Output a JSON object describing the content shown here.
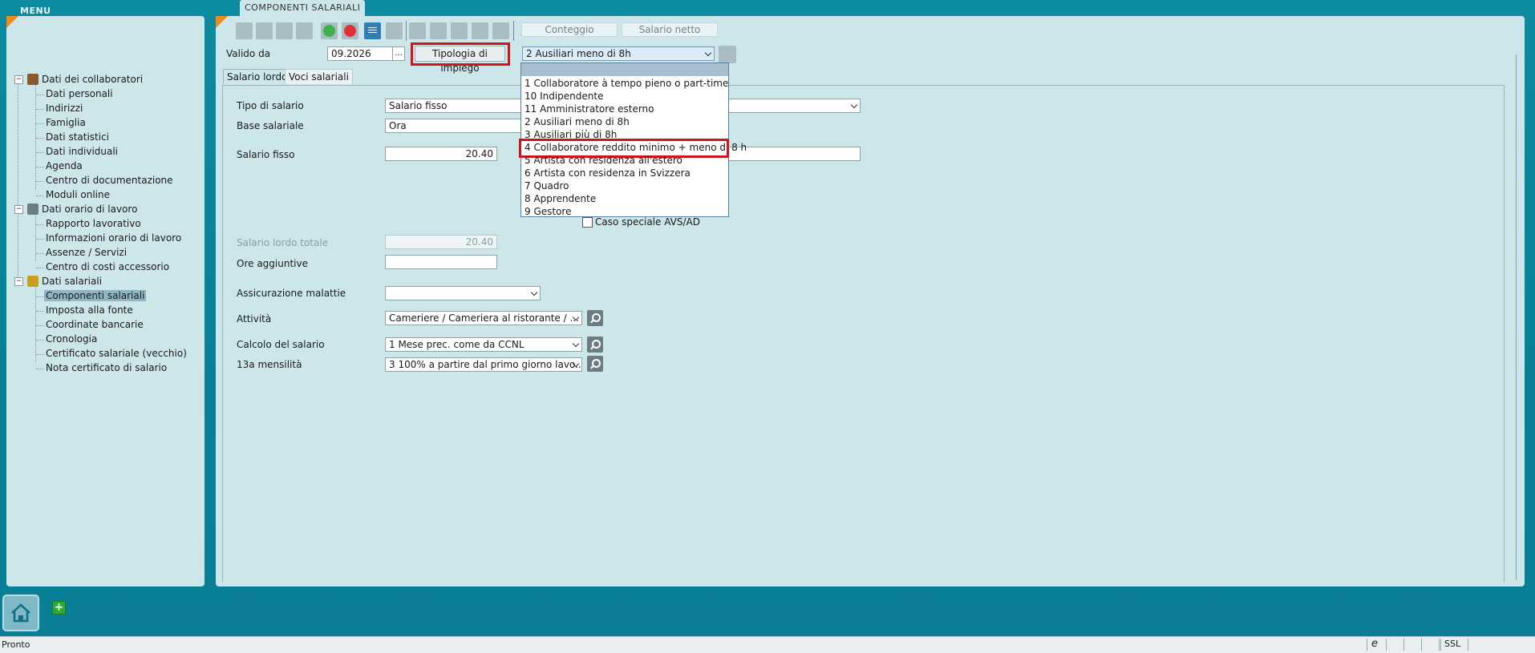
{
  "menu": {
    "title": "MENU",
    "tree": [
      {
        "group": "Dati dei collaboratori",
        "icon": "person-icon",
        "items": [
          "Dati personali",
          "Indirizzi",
          "Famiglia",
          "Dati statistici",
          "Dati individuali",
          "Agenda",
          "Centro di documentazione",
          "Moduli online"
        ]
      },
      {
        "group": "Dati orario di lavoro",
        "icon": "calendar-icon",
        "items": [
          "Rapporto lavorativo",
          "Informazioni orario di lavoro",
          "Assenze / Servizi",
          "Centro di costi accessorio"
        ]
      },
      {
        "group": "Dati salariali",
        "icon": "money-icon",
        "items": [
          "Componenti salariali",
          "Imposta alla fonte",
          "Coordinate bancarie",
          "Cronologia",
          "Certificato salariale (vecchio)",
          "Nota certificato di salario"
        ]
      }
    ],
    "selected": "Componenti salariali"
  },
  "window": {
    "tab_title": "COMPONENTI SALARIALI"
  },
  "toolbar": {
    "conteggio": "Conteggio",
    "salario_netto": "Salario netto"
  },
  "header": {
    "valido_da_label": "Valido da",
    "valido_da_value": "09.2026",
    "picker_label": "...",
    "tipologia_button": "Tipologia di impiego",
    "tipologia_value": "2 Ausiliari meno di 8h"
  },
  "tabs": [
    "Salario lordo",
    "Voci salariali"
  ],
  "dropdown": {
    "options": [
      "1 Collaboratore à tempo pieno o part-time",
      "10 Indipendente",
      "11 Amministratore esterno",
      "2 Ausiliari meno di 8h",
      "3 Ausiliari più di 8h",
      "4 Collaboratore reddito minimo + meno di 8 h",
      "5 Artista con residenza all'estero",
      "6 Artista con residenza in Svizzera",
      "7 Quadro",
      "8 Apprendente",
      "9 Gestore"
    ],
    "highlighted": "4 Collaboratore reddito minimo + meno di 8 h"
  },
  "form": {
    "tipo_salario_label": "Tipo di salario",
    "tipo_salario_value": "Salario fisso",
    "base_salariale_label": "Base salariale",
    "base_salariale_value": "Ora",
    "salario_fisso_label": "Salario fisso",
    "salario_fisso_value": "20.40",
    "caso_speciale_label": "Caso speciale AVS/AD",
    "salario_lordo_totale_label": "Salario lordo totale",
    "salario_lordo_totale_value": "20.40",
    "ore_aggiuntive_label": "Ore aggiuntive",
    "ore_aggiuntive_value": "",
    "assicurazione_label": "Assicurazione malattie",
    "assicurazione_value": "",
    "attivita_label": "Attività",
    "attivita_value": "Cameriere / Cameriera al ristorante / ...",
    "calcolo_label": "Calcolo del salario",
    "calcolo_value": "1 Mese prec. come da CCNL",
    "tredicesima_label": "13a mensilità",
    "tredicesima_value": "3 100% a partire dal primo giorno lavo..."
  },
  "status": {
    "text": "Pronto",
    "ie_glyph": "e",
    "ssl": "SSL"
  }
}
